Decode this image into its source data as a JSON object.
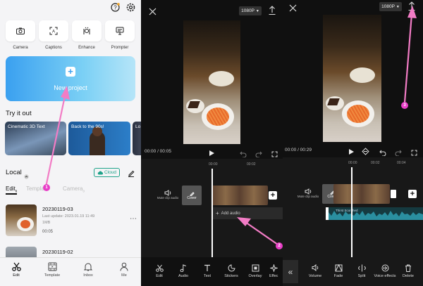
{
  "panel1": {
    "tools": [
      {
        "label": "Camera",
        "icon": "camera-icon"
      },
      {
        "label": "Captions",
        "icon": "captions-icon"
      },
      {
        "label": "Enhance",
        "icon": "enhance-icon"
      },
      {
        "label": "Prompter",
        "icon": "prompter-icon"
      }
    ],
    "new_project": "New project",
    "try_it_out": "Try it out",
    "cards": [
      "Cinematic 3D Text",
      "Back to the 90s!",
      "Lo"
    ],
    "local": "Local",
    "cloud": "Cloud",
    "filter_tabs": [
      "Edit",
      "Template",
      "Camera"
    ],
    "edit_count": "8",
    "camera_count": "0",
    "project1": {
      "name": "20230119-03",
      "updated": "Last update: 2023.01.19 11:49",
      "size": "1MB",
      "duration": "00:05"
    },
    "project2": {
      "name": "20230119-02"
    },
    "nav": [
      "Edit",
      "Template",
      "Inbox",
      "Me"
    ]
  },
  "panel2": {
    "resolution": "1080P",
    "time": "00:00 / 00:05",
    "timeline_marks": [
      "00:00",
      "00:02"
    ],
    "mute_label": "Mute clip audio",
    "cover": "Cover",
    "add_audio": "Add audio",
    "toolbar": [
      "Edit",
      "Audio",
      "Text",
      "Stickers",
      "Overlay",
      "Effec"
    ]
  },
  "panel3": {
    "resolution": "1080P",
    "time": "00:00 / 00:29",
    "timeline_marks": [
      "00:00",
      "00:02",
      "00:04"
    ],
    "mute_label": "Mute clip audio",
    "cover": "Cover",
    "audio_track": "Thirst Scorched",
    "toolbar": [
      "Volume",
      "Fade",
      "Split",
      "Voice effects",
      "Delete"
    ]
  },
  "badges": [
    "1",
    "2",
    "3"
  ],
  "colors": {
    "accent": "#3aa0f0",
    "badge": "#e83ec7",
    "cloud": "#1fa38a",
    "waveform": "#2a8fa0"
  }
}
